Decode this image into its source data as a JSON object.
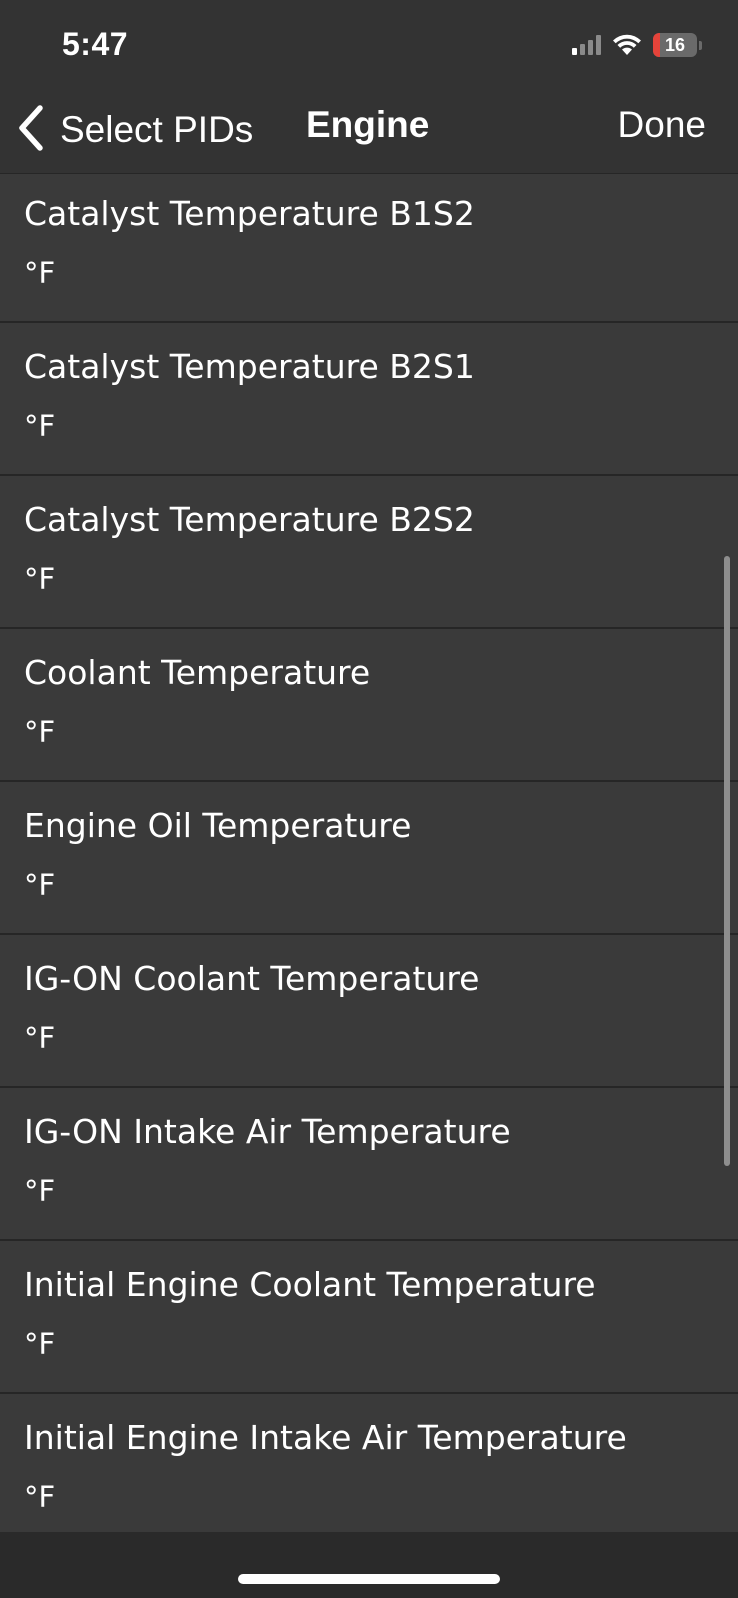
{
  "status_bar": {
    "time": "5:47",
    "battery_level": "16",
    "battery_fraction": 0.16,
    "battery_color": "#e5433a",
    "signal_bars_active": 1,
    "signal_bars_total": 4
  },
  "nav": {
    "back_label": "Select PIDs",
    "title": "Engine",
    "done_label": "Done"
  },
  "pids": [
    {
      "name": "Catalyst Temperature B1S2",
      "unit": "°F"
    },
    {
      "name": "Catalyst Temperature B2S1",
      "unit": "°F"
    },
    {
      "name": "Catalyst Temperature B2S2",
      "unit": "°F"
    },
    {
      "name": "Coolant Temperature",
      "unit": "°F"
    },
    {
      "name": "Engine Oil Temperature",
      "unit": "°F"
    },
    {
      "name": "IG-ON Coolant Temperature",
      "unit": "°F"
    },
    {
      "name": "IG-ON Intake Air Temperature",
      "unit": "°F"
    },
    {
      "name": "Initial Engine Coolant Temperature",
      "unit": "°F"
    },
    {
      "name": "Initial Engine Intake Air Temperature",
      "unit": "°F"
    }
  ],
  "colors": {
    "background": "#3a3a3a",
    "bar_background": "#333333",
    "separator": "#262626",
    "text": "#ffffff"
  }
}
